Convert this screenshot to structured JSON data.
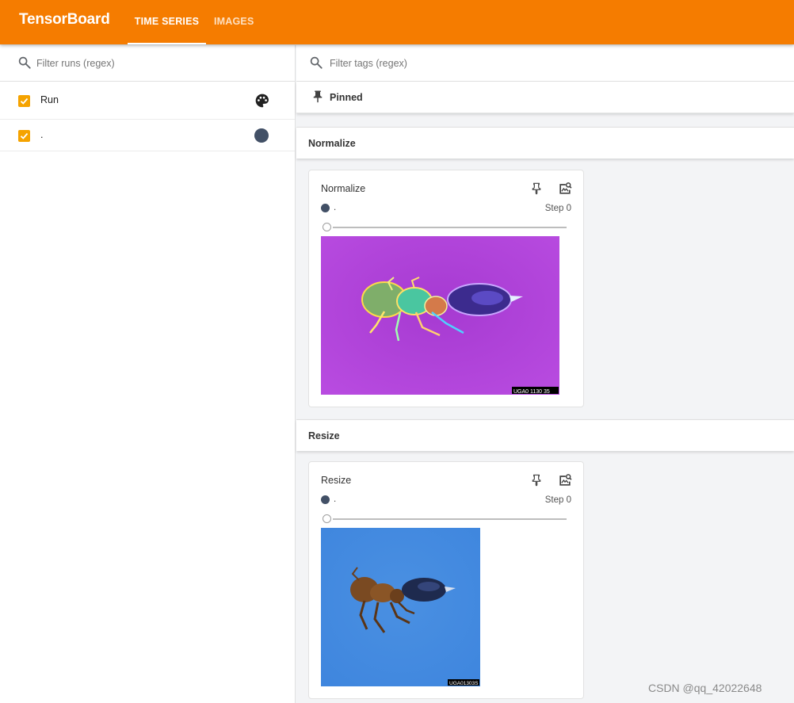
{
  "app": {
    "title": "TensorBoard",
    "accent_color": "#f57c00",
    "tabs": [
      {
        "label": "TIME SERIES",
        "active": true
      },
      {
        "label": "IMAGES",
        "active": false
      }
    ]
  },
  "sidebar": {
    "filter_placeholder": "Filter runs (regex)",
    "filter_icon": "search-icon",
    "runs": [
      {
        "label": "Run",
        "checked": true,
        "icon": "palette-icon"
      },
      {
        "label": ".",
        "checked": true,
        "color": "#425066"
      }
    ]
  },
  "main": {
    "tag_filter_placeholder": "Filter tags (regex)",
    "pinned_label": "Pinned",
    "groups": [
      {
        "name": "Normalize",
        "card": {
          "title": "Normalize",
          "run_name": ".",
          "step_label": "Step 0",
          "slider_value": 0,
          "image_icon_pin": "pin-icon",
          "image_icon_zoom": "image-search-icon",
          "image_caption": "UGA0 1130 35"
        }
      },
      {
        "name": "Resize",
        "card": {
          "title": "Resize",
          "run_name": ".",
          "step_label": "Step 0",
          "slider_value": 0,
          "image_icon_pin": "pin-icon",
          "image_icon_zoom": "image-search-icon",
          "image_caption": "UGA01303S"
        }
      }
    ]
  },
  "watermark": "CSDN @qq_42022648"
}
